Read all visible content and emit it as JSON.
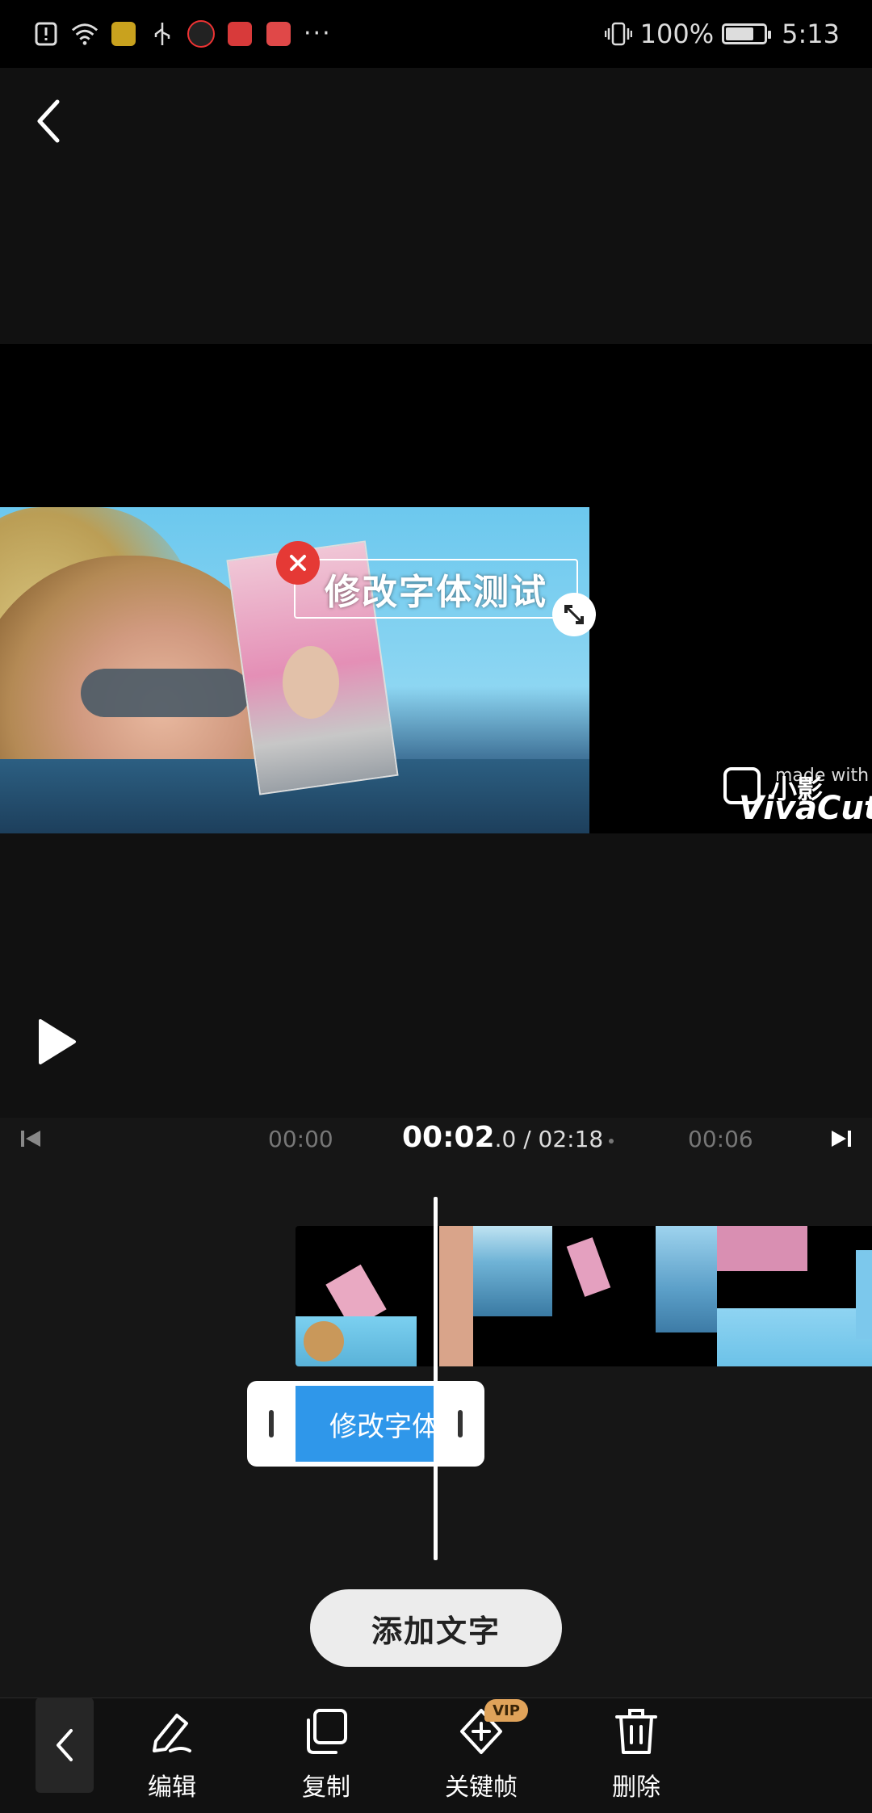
{
  "status_bar": {
    "battery_percent": "100%",
    "time": "5:13",
    "overflow": "···",
    "battery_level": 0.75
  },
  "preview": {
    "text_overlay": "修改字体测试",
    "watermark": {
      "made_with": "made with",
      "brand_cn": "小影",
      "brand": "VivaCut"
    }
  },
  "timeline": {
    "ticks": [
      "00:00",
      "00:06"
    ],
    "current_time_main": "00:02",
    "current_time_frac": ".0",
    "total": " / 02:18",
    "text_clip_label": "修改字体测试"
  },
  "actions": {
    "add_text": "添加文字"
  },
  "toolbar": {
    "edit": "编辑",
    "copy": "复制",
    "keyframe": "关键帧",
    "delete": "删除",
    "vip_badge": "VIP"
  },
  "colors": {
    "accent_blue": "#2f97ea",
    "close_red": "#e53935",
    "vip_gold": "#e0a35a"
  }
}
